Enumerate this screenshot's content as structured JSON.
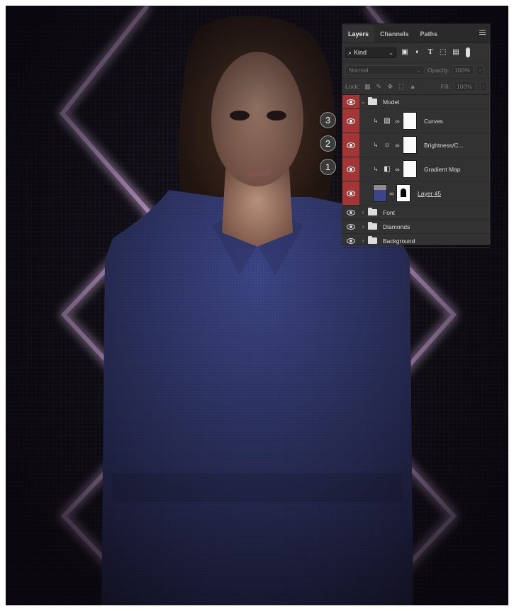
{
  "canvas": {
    "background": "#141218",
    "neon_color": "#e79cff",
    "jacket_color": "#3d4686"
  },
  "panel": {
    "tabs": [
      {
        "label": "Layers",
        "active": true
      },
      {
        "label": "Channels",
        "active": false
      },
      {
        "label": "Paths",
        "active": false
      }
    ],
    "menu_icon": "panel-menu-icon",
    "filter": {
      "kind_label": "Kind",
      "icons": [
        "image-filter-icon",
        "adjustment-filter-icon",
        "type-filter-icon",
        "shape-filter-icon",
        "smart-object-filter-icon"
      ]
    },
    "blend_mode": "Normal",
    "opacity_label": "Opacity:",
    "opacity_value": "100%",
    "lock_label": "Lock:",
    "fill_label": "Fill:",
    "fill_value": "100%",
    "layers": [
      {
        "name": "Model",
        "type": "group",
        "expanded": true,
        "eye_highlight": true
      },
      {
        "name": "Curves",
        "type": "adjustment",
        "icon": "curves-icon",
        "badge": "3",
        "eye_highlight": true
      },
      {
        "name": "Brightness/C...",
        "type": "adjustment",
        "icon": "brightness-icon",
        "badge": "2",
        "eye_highlight": true
      },
      {
        "name": "Gradient Map",
        "type": "adjustment",
        "icon": "gradient-map-icon",
        "badge": "1",
        "eye_highlight": true
      },
      {
        "name": "Layer 45",
        "type": "pixel",
        "eye_highlight": true
      },
      {
        "name": "Font",
        "type": "group",
        "expanded": false,
        "eye_highlight": false
      },
      {
        "name": "Diamonds",
        "type": "group",
        "expanded": false,
        "eye_highlight": false
      },
      {
        "name": "Background",
        "type": "group",
        "expanded": false,
        "eye_highlight": false
      }
    ]
  }
}
